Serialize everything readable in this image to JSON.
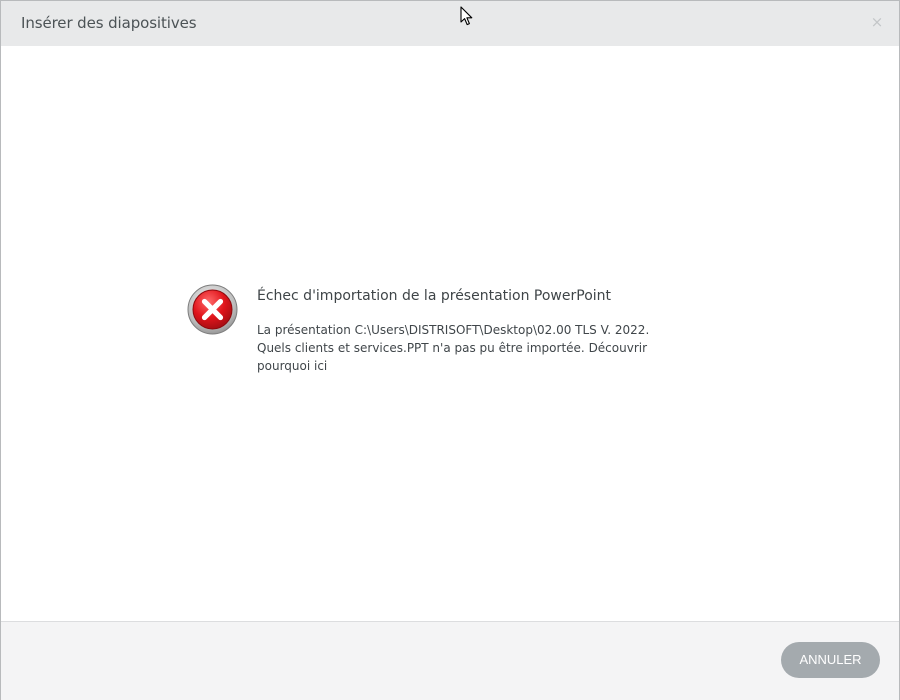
{
  "dialog": {
    "title": "Insérer des diapositives",
    "close_glyph": "×",
    "close_icon": "close-icon"
  },
  "error": {
    "icon": "error-x-circle-icon",
    "title": "Échec d'importation de la présentation PowerPoint",
    "message": "La présentation C:\\Users\\DISTRISOFT\\Desktop\\02.00 TLS V. 2022. Quels clients  et services.PPT n'a pas pu être importée.",
    "link_text": "Découvrir pourquoi ici"
  },
  "footer": {
    "cancel_label": "ANNULER"
  },
  "colors": {
    "title_bar": "#e8e9ea",
    "footer": "#f4f4f5",
    "cancel_button": "#a4aaae",
    "error_red": "#d8161d"
  }
}
